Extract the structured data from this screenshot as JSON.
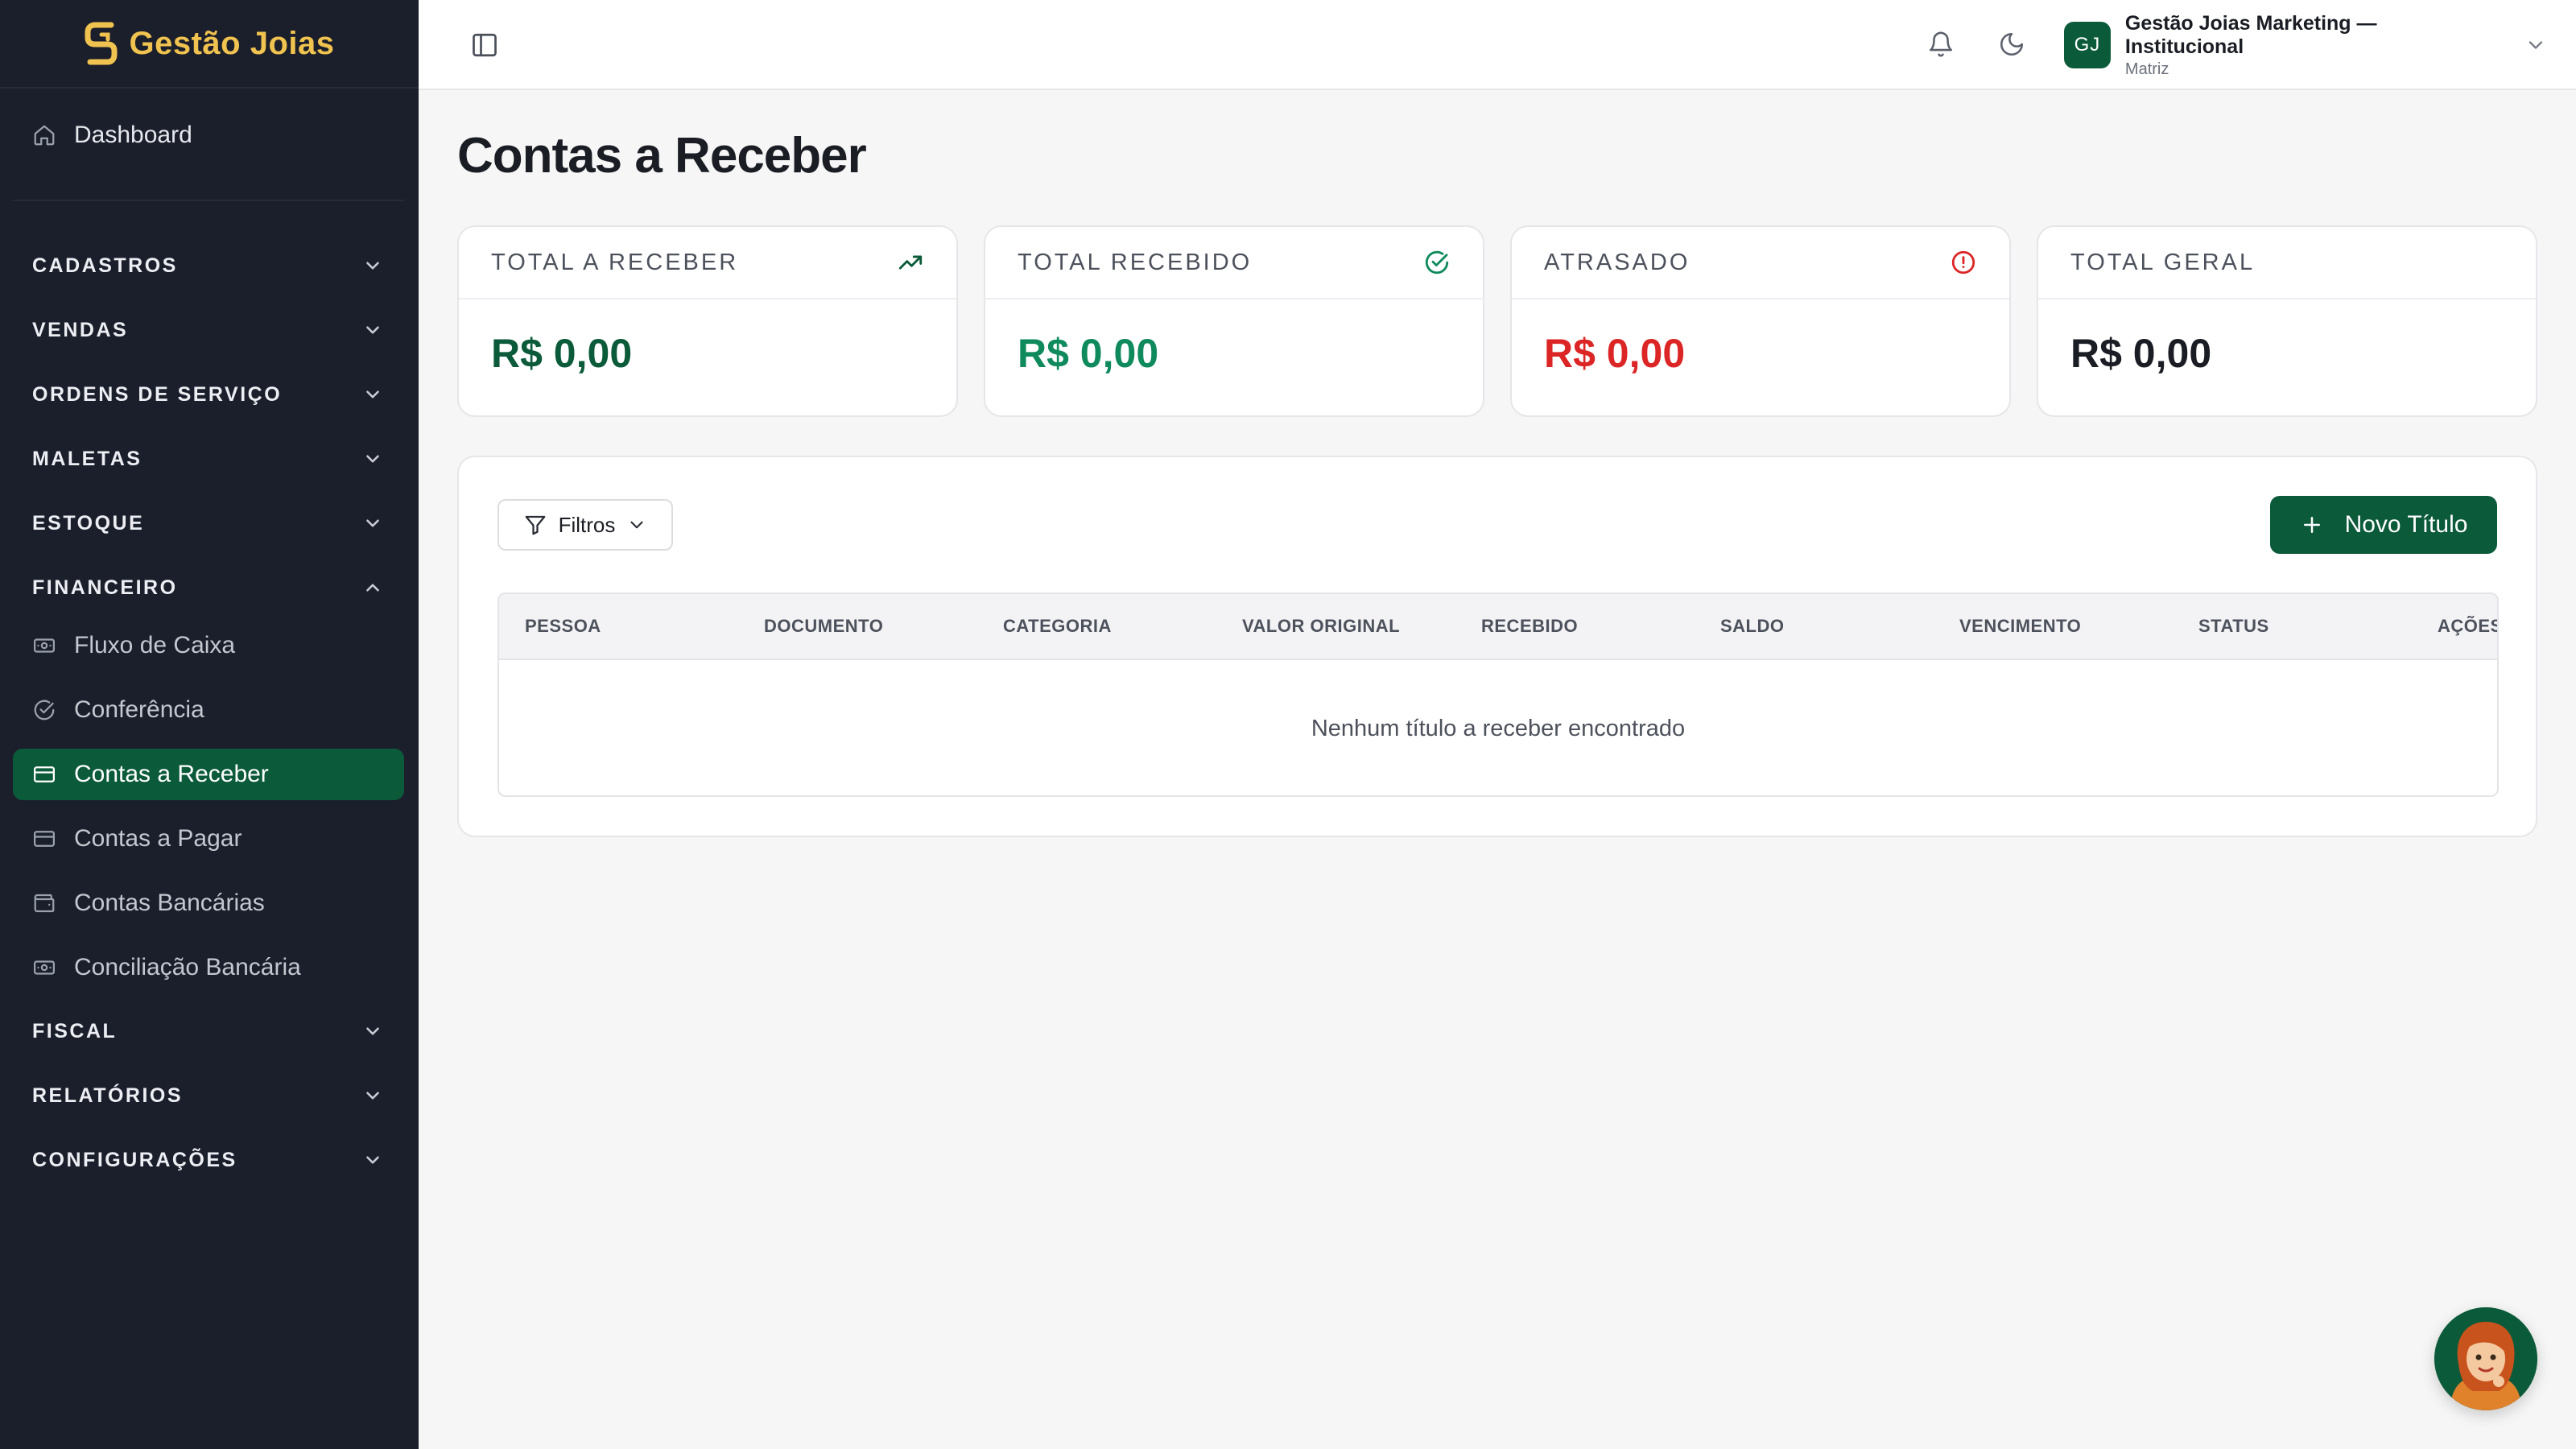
{
  "brand": {
    "name": "Gestão Joias"
  },
  "sidebar": {
    "dashboard": "Dashboard",
    "sections": [
      {
        "label": "CADASTROS",
        "expanded": false
      },
      {
        "label": "VENDAS",
        "expanded": false
      },
      {
        "label": "ORDENS DE SERVIÇO",
        "expanded": false
      },
      {
        "label": "MALETAS",
        "expanded": false
      },
      {
        "label": "ESTOQUE",
        "expanded": false
      },
      {
        "label": "FINANCEIRO",
        "expanded": true
      },
      {
        "label": "FISCAL",
        "expanded": false
      },
      {
        "label": "RELATÓRIOS",
        "expanded": false
      },
      {
        "label": "CONFIGURAÇÕES",
        "expanded": false
      }
    ],
    "financeiro_items": [
      {
        "label": "Fluxo de Caixa",
        "icon": "cash-icon"
      },
      {
        "label": "Conferência",
        "icon": "check-circle-icon"
      },
      {
        "label": "Contas a Receber",
        "icon": "card-icon",
        "active": true
      },
      {
        "label": "Contas a Pagar",
        "icon": "card-icon"
      },
      {
        "label": "Contas Bancárias",
        "icon": "wallet-icon"
      },
      {
        "label": "Conciliação Bancária",
        "icon": "cash-icon"
      }
    ]
  },
  "topbar": {
    "org_initials": "GJ",
    "org_name": "Gestão Joias Marketing — Institucional",
    "org_branch": "Matriz"
  },
  "page": {
    "title": "Contas a Receber"
  },
  "stats": [
    {
      "label": "TOTAL A RECEBER",
      "value": "R$ 0,00",
      "color": "#0b5a3a",
      "icon": "trending-up-icon"
    },
    {
      "label": "TOTAL RECEBIDO",
      "value": "R$ 0,00",
      "color": "#0f8a5c",
      "icon": "check-circle-icon"
    },
    {
      "label": "ATRASADO",
      "value": "R$ 0,00",
      "color": "#dc2626",
      "icon": "alert-circle-icon"
    },
    {
      "label": "TOTAL GERAL",
      "value": "R$ 0,00",
      "color": "#1b1d24",
      "icon": ""
    }
  ],
  "toolbar": {
    "filter_label": "Filtros",
    "new_label": "Novo Título"
  },
  "table": {
    "columns": [
      "PESSOA",
      "DOCUMENTO",
      "CATEGORIA",
      "VALOR ORIGINAL",
      "RECEBIDO",
      "SALDO",
      "VENCIMENTO",
      "STATUS",
      "AÇÕES"
    ],
    "empty_message": "Nenhum título a receber encontrado"
  },
  "colors": {
    "accent": "#0b5a3a",
    "brand_gold": "#f0c24f",
    "sidebar_bg": "#1b1f2b"
  }
}
